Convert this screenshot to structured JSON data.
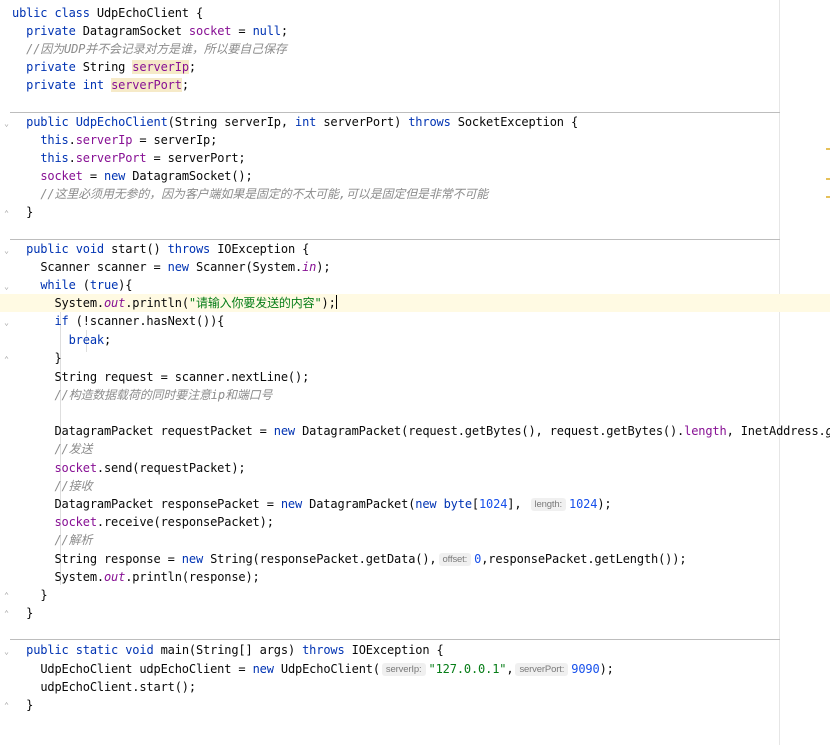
{
  "editor": {
    "class_decl": {
      "kw_public": "ublic",
      "kw_class": "class",
      "name": "UdpEchoClient",
      "brace": "{"
    },
    "field_socket": {
      "kw": "private",
      "type": "DatagramSocket",
      "name": "socket",
      "rest": " = ",
      "null_kw": "null",
      "end": ";"
    },
    "comment_udp": "//因为UDP并不会记录对方是谁，所以要自己保存",
    "field_server_ip": {
      "kw": "private",
      "type": "String",
      "name": "serverIp",
      "end": ";"
    },
    "field_server_port": {
      "kw": "private",
      "type": "int",
      "name": "serverPort",
      "end": ";"
    },
    "ctor_sig": {
      "kw_public": "public",
      "name": "UdpEchoClient",
      "params_a": "(String serverIp, ",
      "kw_int": "int",
      "params_b": " serverPort) ",
      "kw_throws": "throws",
      "exc": " SocketException {"
    },
    "ctor_l1": {
      "this": "this",
      "dot": ".",
      "field": "serverIp",
      "rest": " = serverIp;"
    },
    "ctor_l2": {
      "this": "this",
      "dot": ".",
      "field": "serverPort",
      "rest": " = serverPort;"
    },
    "ctor_l3": {
      "field": "socket",
      "eq": " = ",
      "kw_new": "new",
      "rest": " DatagramSocket();"
    },
    "ctor_comment": "//这里必须用无参的，因为客户端如果是固定的不太可能,可以是固定但是非常不可能",
    "close_brace": "}",
    "start_sig": {
      "kw_public": "public",
      "kw_void": "void",
      "rest_a": " start() ",
      "kw_throws": "throws",
      "rest_b": " IOException {"
    },
    "scanner_line": {
      "a": "Scanner scanner = ",
      "kw_new": "new",
      "b": " Scanner(System.",
      "in": "in",
      "c": ");"
    },
    "while_line": {
      "kw_while": "while",
      "a": " (",
      "kw_true": "true",
      "b": "){"
    },
    "println_prompt": {
      "a": "System.",
      "out": "out",
      "b": ".println(",
      "str": "\"请输入你要发送的内容\"",
      "c": ");"
    },
    "if_line": {
      "kw_if": "if",
      "rest": " (!scanner.hasNext()){"
    },
    "break_line": {
      "kw_break": "break",
      "end": ";"
    },
    "request_line": "String request = scanner.nextLine();",
    "comment_construct": "//构造数据载荷的同时要注意ip和端口号",
    "request_packet": {
      "a": "DatagramPacket requestPacket = ",
      "kw_new": "new",
      "b": " DatagramPacket(request.getBytes(), request.getBytes().",
      "length": "length",
      "c": ", InetAddress.",
      "getbyname": "getByName"
    },
    "comment_send": "//发送",
    "send_line": {
      "field": "socket",
      "rest": ".send(requestPacket);"
    },
    "comment_receive": "//接收",
    "response_packet": {
      "a": "DatagramPacket responsePacket = ",
      "kw_new": "new",
      "b": " DatagramPacket(",
      "kw_new2": "new",
      "kw_byte": "byte",
      "c": "[",
      "num": "1024",
      "d": "], ",
      "hint": "length:",
      "num2": "1024",
      "e": ");"
    },
    "receive_line": {
      "field": "socket",
      "rest": ".receive(responsePacket);"
    },
    "comment_parse": "//解析",
    "response_line": {
      "a": "String response = ",
      "kw_new": "new",
      "b": " String(responsePacket.getData(),",
      "hint": "offset:",
      "num": "0",
      "c": ",responsePacket.getLength());"
    },
    "println_response": {
      "a": "System.",
      "out": "out",
      "b": ".println(response);"
    },
    "main_sig": {
      "kw_public": "public",
      "kw_static": "static",
      "kw_void": "void",
      "rest_a": " main(String[] args) ",
      "kw_throws": "throws",
      "rest_b": " IOException {"
    },
    "main_l1": {
      "a": "UdpEchoClient udpEchoClient = ",
      "kw_new": "new",
      "b": " UdpEchoClient(",
      "hint1": "serverIp:",
      "str": "\"127.0.0.1\"",
      "c": ",",
      "hint2": "serverPort:",
      "num": "9090",
      "d": ");"
    },
    "main_l2": "udpEchoClient.start();"
  },
  "colors": {
    "keyword": "#0033b3",
    "field": "#871094",
    "comment": "#8c8c8c",
    "string": "#067d17",
    "number": "#1750eb",
    "current_line": "#fffae3"
  }
}
